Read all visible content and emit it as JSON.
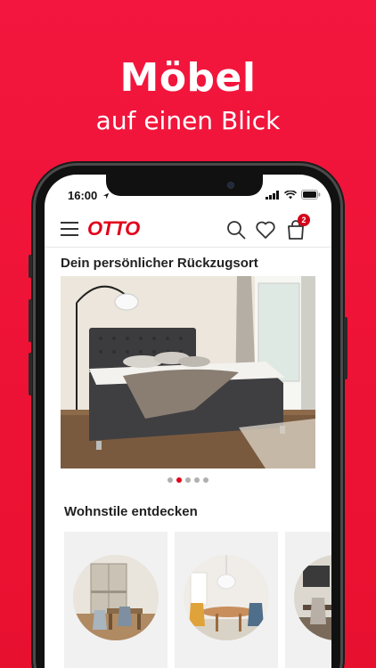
{
  "promo": {
    "headline": "Möbel",
    "subline": "auf einen Blick"
  },
  "status_bar": {
    "time": "16:00"
  },
  "header": {
    "logo": "OTTO",
    "cart_count": "2"
  },
  "hero": {
    "title": "Dein persönlicher Rückzugsort",
    "carousel_pages": 5,
    "active_page": 2
  },
  "styles": {
    "title": "Wohnstile entdecken"
  },
  "colors": {
    "brand_red": "#e2001a",
    "background": "#f3163e"
  },
  "icons": [
    "menu-icon",
    "search-icon",
    "heart-icon",
    "cart-icon",
    "location-arrow-icon",
    "signal-icon",
    "wifi-icon",
    "battery-icon"
  ]
}
